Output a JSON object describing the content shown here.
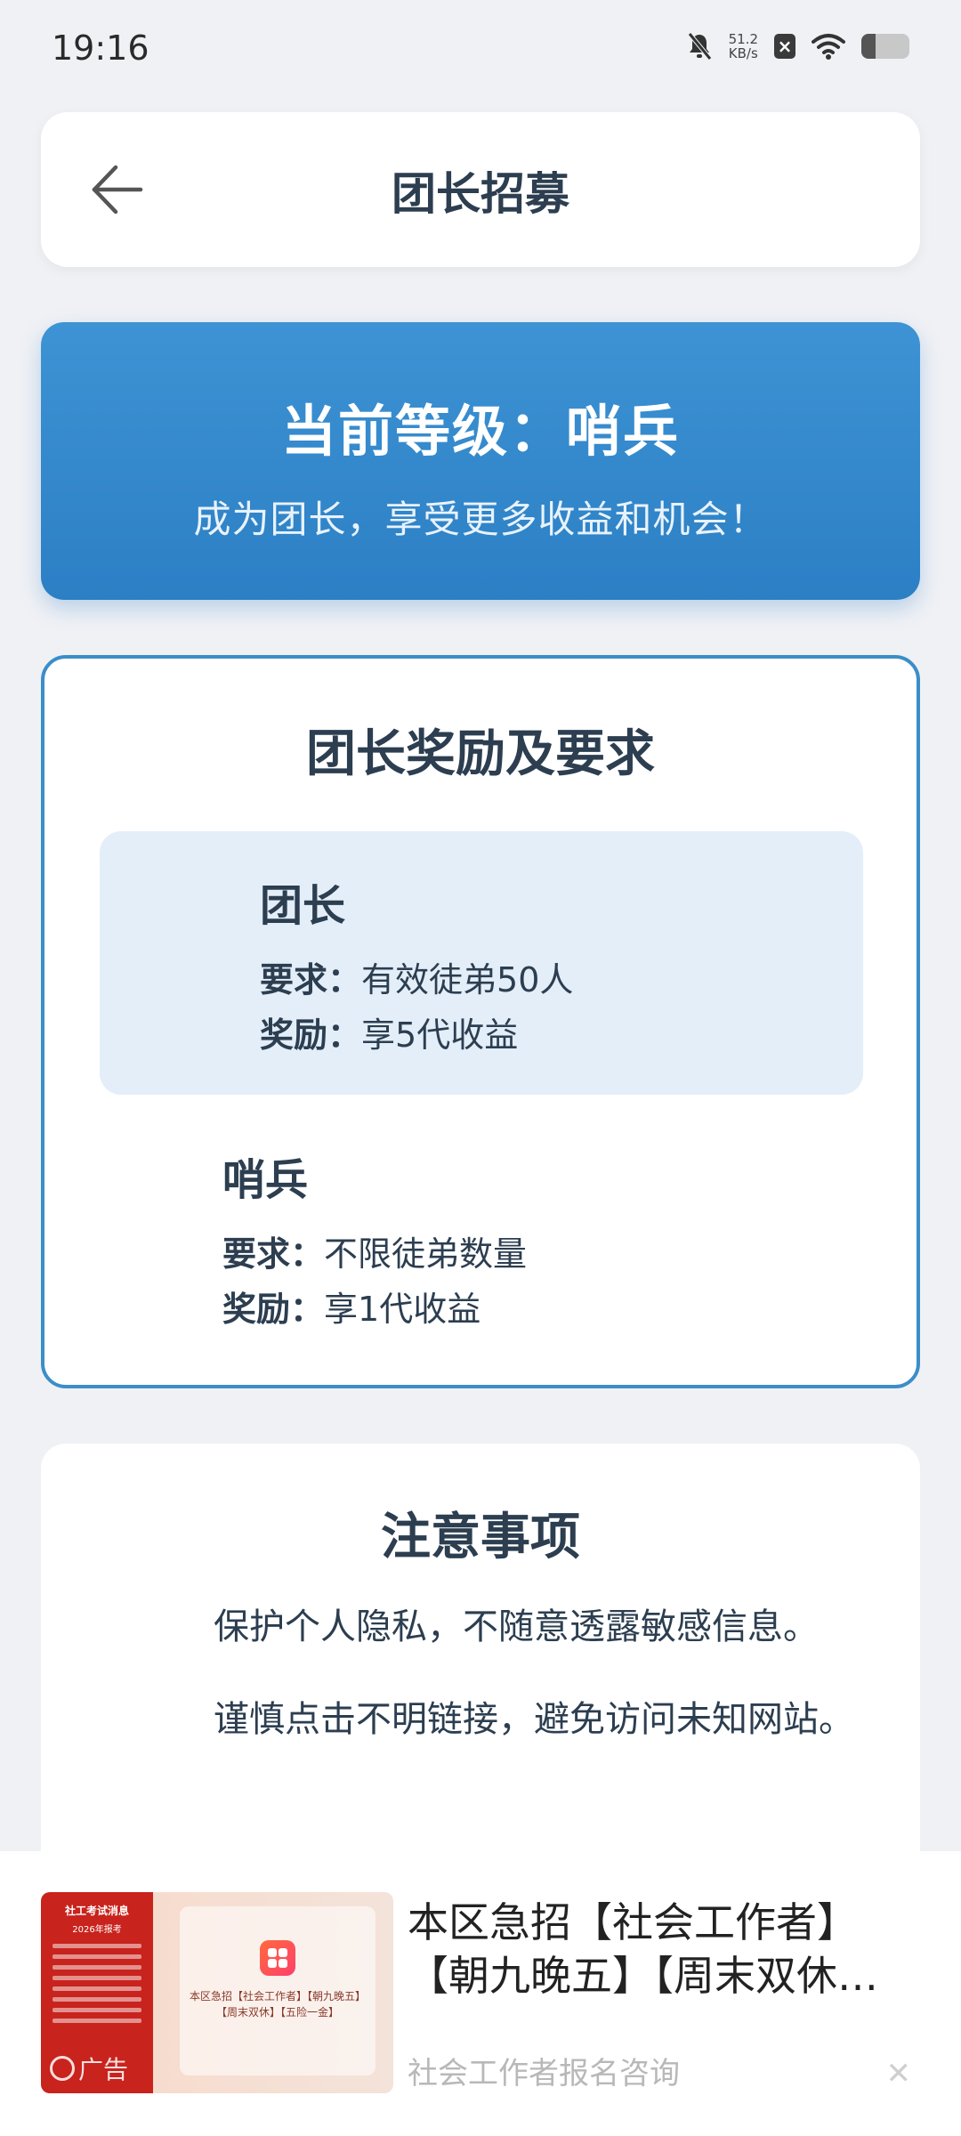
{
  "status_bar": {
    "time": "19:16",
    "network_speed_value": "51.2",
    "network_speed_unit": "KB/s",
    "battery_level": 0.3
  },
  "header": {
    "title": "团长招募"
  },
  "level_card": {
    "title": "当前等级：哨兵",
    "subtitle": "成为团长，享受更多收益和机会！",
    "color": "#2f86c9"
  },
  "rewards": {
    "title": "团长奖励及要求",
    "tiers": [
      {
        "name": "团长",
        "requirement_label": "要求：",
        "requirement": "有效徒弟50人",
        "reward_label": "奖励：",
        "reward": "享5代收益",
        "highlighted": true
      },
      {
        "name": "哨兵",
        "requirement_label": "要求：",
        "requirement": "不限徒弟数量",
        "reward_label": "奖励：",
        "reward": "享1代收益",
        "highlighted": false
      }
    ]
  },
  "notice": {
    "title": "注意事项",
    "items": [
      "保护个人隐私，不随意透露敏感信息。",
      "谨慎点击不明链接，避免访问未知网站。"
    ]
  },
  "ad": {
    "title": "本区急招【社会工作者】【朝九晚五】【周末双休】【五险一金】",
    "subtitle": "社会工作者报名咨询",
    "badge": "广告",
    "image_left_title": "社工考试消息",
    "image_left_year": "2026年报考",
    "image_text": "本区急招【社会工作者】【朝九晚五】【周末双休】【五险一金】",
    "close_icon": "close-icon"
  }
}
